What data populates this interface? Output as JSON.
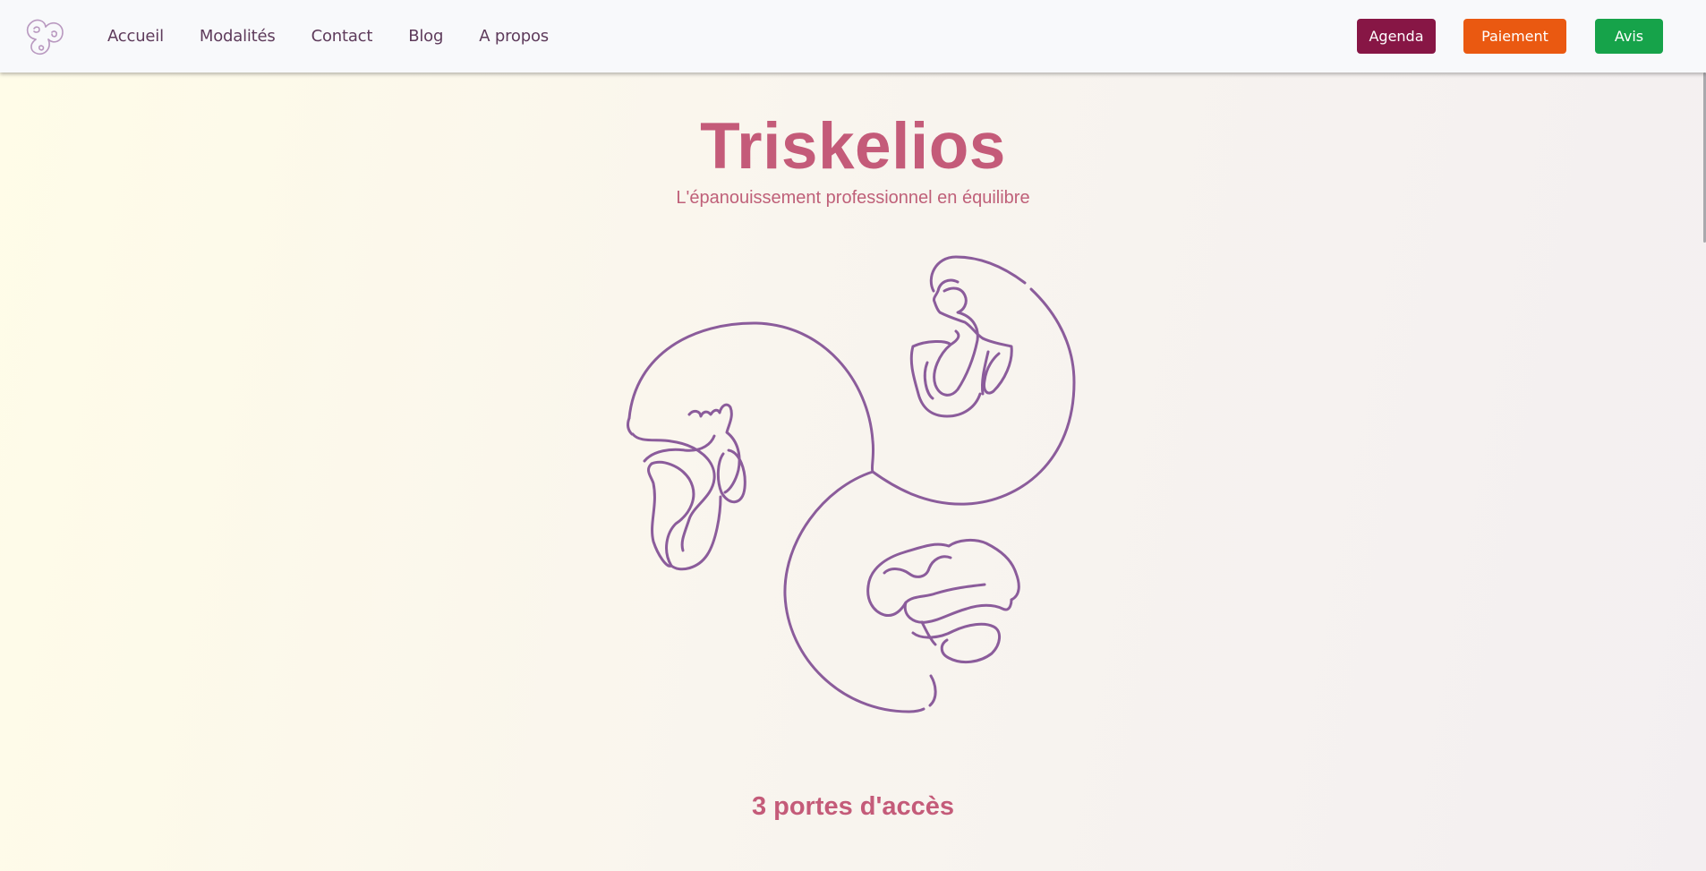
{
  "nav": {
    "logo_icon": "triskelion-logo-icon",
    "links": [
      {
        "label": "Accueil"
      },
      {
        "label": "Modalités"
      },
      {
        "label": "Contact"
      },
      {
        "label": "Blog"
      },
      {
        "label": "A propos"
      }
    ],
    "buttons": {
      "agenda": {
        "label": "Agenda",
        "color": "#871645"
      },
      "paiement": {
        "label": "Paiement",
        "color": "#ea5911"
      },
      "avis": {
        "label": "Avis",
        "color": "#16a34a"
      }
    }
  },
  "hero": {
    "title": "Triskelios",
    "subtitle": "L'épanouissement professionnel en équilibre",
    "illustration_icon": "triskelion-heart-body-brain-icon"
  },
  "section": {
    "title": "3 portes d'accès"
  },
  "colors": {
    "accent": "#c45b79",
    "line_art": "#8b5c9b",
    "nav_text": "#5e3b5b"
  }
}
